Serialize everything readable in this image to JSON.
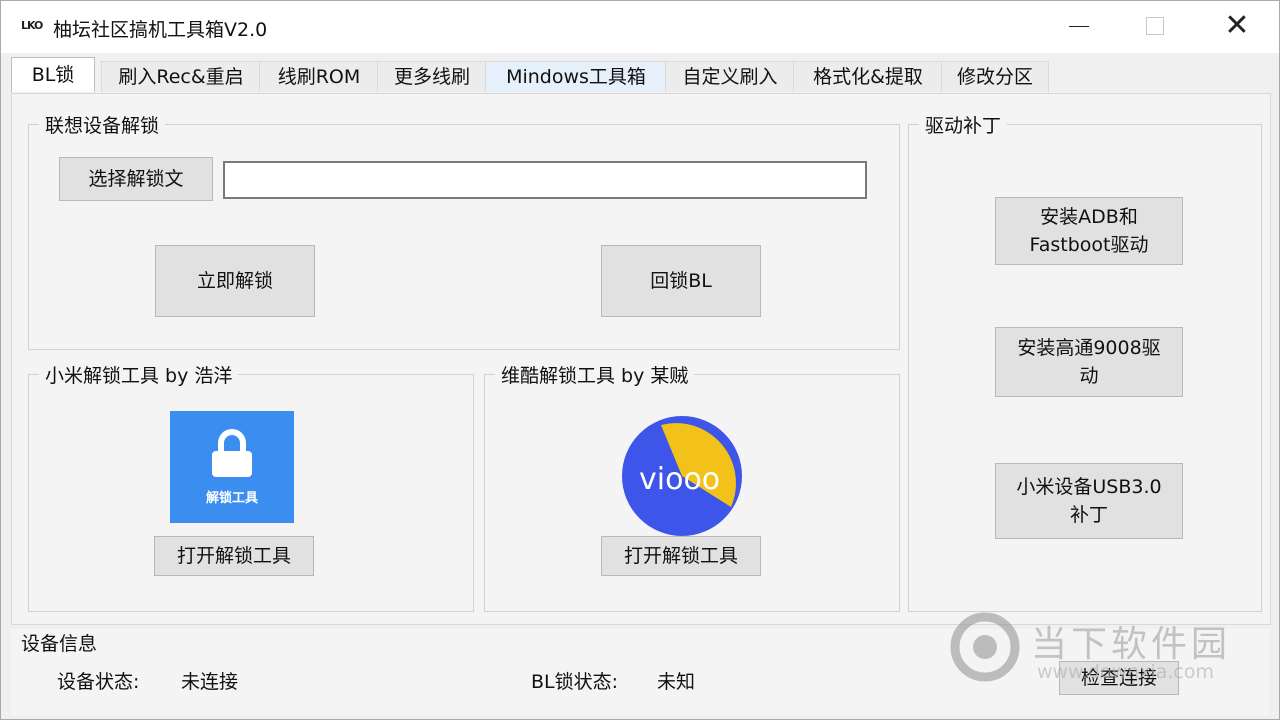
{
  "window": {
    "icon_text": "LKO",
    "title": "柚坛社区搞机工具箱V2.0"
  },
  "tabs": [
    {
      "label": "BL锁"
    },
    {
      "label": "刷入Rec&重启"
    },
    {
      "label": "线刷ROM"
    },
    {
      "label": "更多线刷"
    },
    {
      "label": "Mindows工具箱"
    },
    {
      "label": "自定义刷入"
    },
    {
      "label": "格式化&提取"
    },
    {
      "label": "修改分区"
    }
  ],
  "lenovo_unlock": {
    "title": "联想设备解锁",
    "choose_file_label": "选择解锁文",
    "file_path_value": "",
    "unlock_now_label": "立即解锁",
    "relock_label": "回锁BL"
  },
  "xiaomi_unlock": {
    "title": "小米解锁工具 by 浩洋",
    "logo_caption": "解锁工具",
    "open_label": "打开解锁工具"
  },
  "vivo_unlock": {
    "title": "维酷解锁工具 by 某贼",
    "logo_text": "viooo",
    "open_label": "打开解锁工具"
  },
  "drivers": {
    "title": "驱动补丁",
    "adb_line1": "安装ADB和",
    "adb_line2": "Fastboot驱动",
    "qualcomm_line1": "安装高通9008驱",
    "qualcomm_line2": "动",
    "usb3_line1": "小米设备USB3.0",
    "usb3_line2": "补丁"
  },
  "device_info": {
    "title": "设备信息",
    "device_status_label": "设备状态:",
    "device_status_value": "未连接",
    "bl_status_label": "BL锁状态:",
    "bl_status_value": "未知",
    "check_button_label": "检查连接"
  },
  "watermark": {
    "text": "当下软件园",
    "url": "www.downxia.com"
  },
  "colors": {
    "lock_logo_bg": "#3b8ef0",
    "vivo_blue": "#3d55e8",
    "vivo_yellow": "#f3c21a"
  }
}
